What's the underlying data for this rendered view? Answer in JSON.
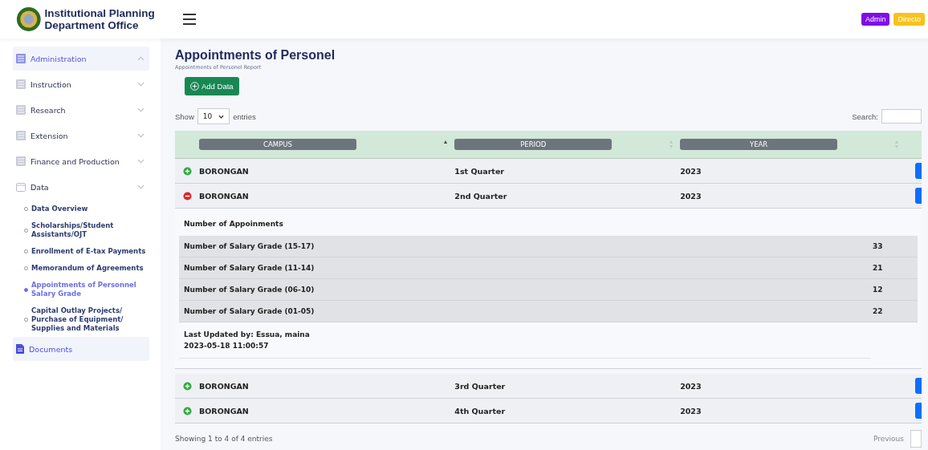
{
  "brand": {
    "title": "Institutional Planning Department Office"
  },
  "header": {
    "badges": [
      {
        "label": "Admin",
        "color": "#7e0ee6"
      },
      {
        "label": "Directo",
        "color": "#f7c31b"
      }
    ]
  },
  "sidebar": {
    "items": [
      {
        "label": "Administration",
        "kind": "group",
        "expanded": true,
        "selected": true
      },
      {
        "label": "Instruction",
        "kind": "group",
        "expanded": false,
        "selected": false
      },
      {
        "label": "Research",
        "kind": "group",
        "expanded": false,
        "selected": false
      },
      {
        "label": "Extension",
        "kind": "group",
        "expanded": false,
        "selected": false
      },
      {
        "label": "Finance and Production",
        "kind": "group",
        "expanded": false,
        "selected": false
      },
      {
        "label": "Data",
        "kind": "folder",
        "expanded": false,
        "selected": false,
        "children": [
          {
            "label": "Data Overview",
            "selected": false
          },
          {
            "label": "Scholarships/Student Assistants/OJT",
            "selected": false
          },
          {
            "label": "Enrollment of E-tax Payments",
            "selected": false
          },
          {
            "label": "Memorandum of Agreements",
            "selected": false
          },
          {
            "label": "Appointments of Personnel Salary Grade",
            "selected": true
          },
          {
            "label": "Capital Outlay Projects/ Purchase of Equipment/ Supplies and Materials",
            "selected": false
          }
        ]
      },
      {
        "label": "Documents",
        "kind": "document",
        "selected": true
      }
    ]
  },
  "page": {
    "title": "Appointments of Personel",
    "subtitle": "Appointments of Personel Report",
    "add_button": "Add Data"
  },
  "table": {
    "show_label": "Show",
    "page_size": "10",
    "entries_label": "entries",
    "search_label": "Search:",
    "columns": [
      {
        "label": "CAMPUS",
        "sorted": true
      },
      {
        "label": "PERIOD",
        "sorted": false
      },
      {
        "label": "YEAR",
        "sorted": false
      }
    ],
    "rows": [
      {
        "campus": "BORONGAN",
        "period": "1st Quarter",
        "year": "2023",
        "expanded": false
      },
      {
        "campus": "BORONGAN",
        "period": "2nd Quarter",
        "year": "2023",
        "expanded": true,
        "detail": {
          "heading": "Number of Appoinments",
          "items": [
            {
              "label": "Number of Salary Grade (15-17)",
              "value": "33"
            },
            {
              "label": "Number of Salary Grade (11-14)",
              "value": "21"
            },
            {
              "label": "Number of Salary Grade (06-10)",
              "value": "12"
            },
            {
              "label": "Number of Salary Grade (01-05)",
              "value": "22"
            }
          ],
          "updated_by": "Last Updated by: Essua, maina",
          "updated_at": "2023-05-18 11:00:57"
        }
      },
      {
        "campus": "BORONGAN",
        "period": "3rd Quarter",
        "year": "2023",
        "expanded": false
      },
      {
        "campus": "BORONGAN",
        "period": "4th Quarter",
        "year": "2023",
        "expanded": false
      }
    ],
    "info": "Showing 1 to 4 of 4 entries",
    "previous": "Previous"
  }
}
